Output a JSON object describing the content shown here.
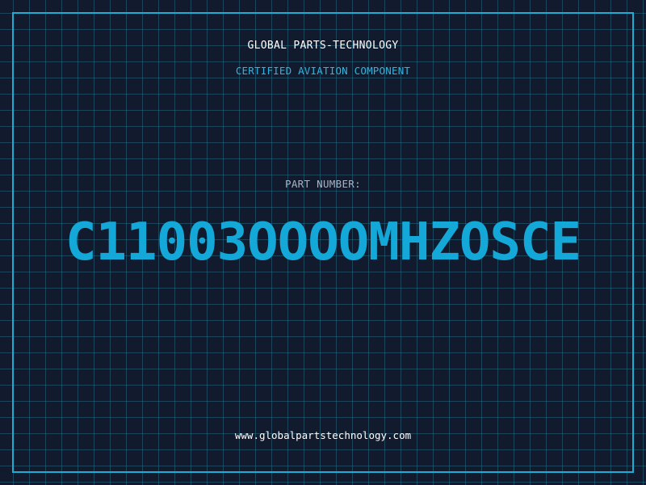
{
  "header": {
    "company": "GLOBAL PARTS-TECHNOLOGY",
    "subtitle": "CERTIFIED AVIATION COMPONENT"
  },
  "part": {
    "label": "PART NUMBER:",
    "number": "C11003OOOOMHZOSCE"
  },
  "footer": {
    "url": "www.globalpartstechnology.com"
  },
  "colors": {
    "background": "#121b2d",
    "grid": "#28788f",
    "accent": "#1aaed4",
    "text_primary": "#ffffff",
    "text_muted": "#aab4c6"
  }
}
